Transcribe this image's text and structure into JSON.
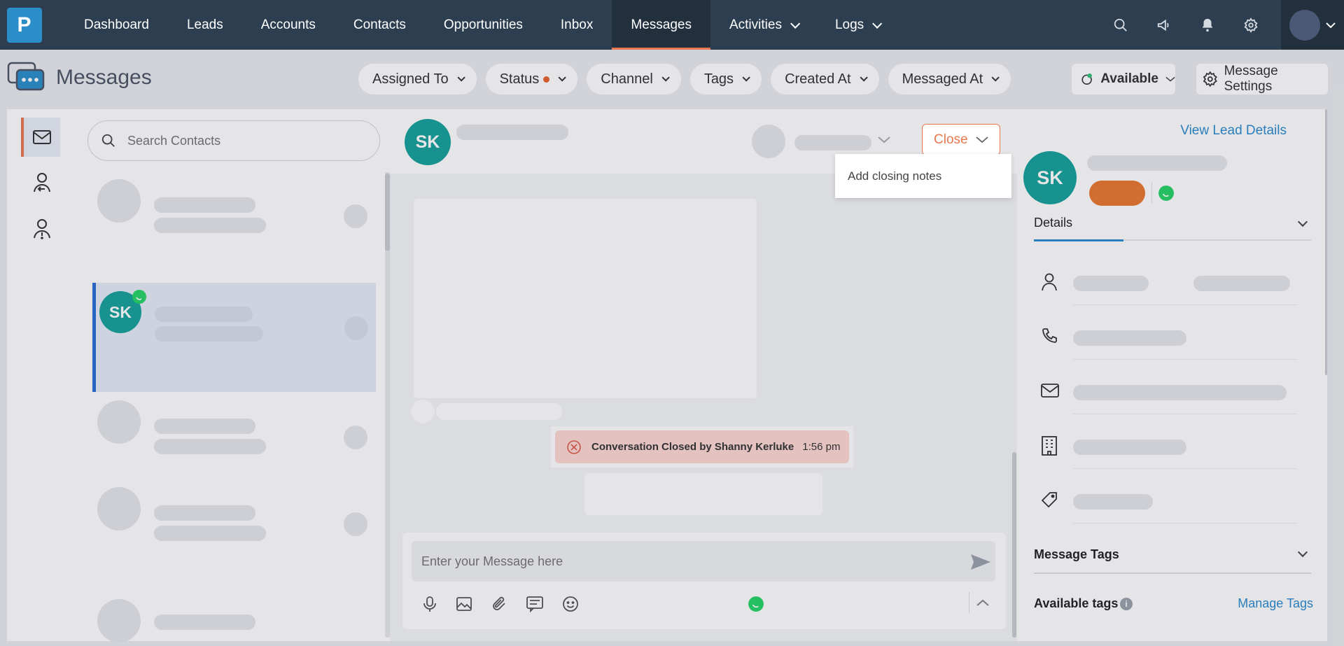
{
  "nav": {
    "logo_letter": "P",
    "items": [
      {
        "label": "Dashboard"
      },
      {
        "label": "Leads"
      },
      {
        "label": "Accounts"
      },
      {
        "label": "Contacts"
      },
      {
        "label": "Opportunities"
      },
      {
        "label": "Inbox"
      },
      {
        "label": "Messages",
        "active": true
      },
      {
        "label": "Activities",
        "dropdown": true
      },
      {
        "label": "Logs",
        "dropdown": true
      }
    ],
    "icons": [
      "search-icon",
      "megaphone-icon",
      "bell-icon",
      "gear-icon"
    ]
  },
  "page": {
    "title": "Messages",
    "filters": [
      "Assigned To",
      "Status",
      "Channel",
      "Tags",
      "Created At",
      "Messaged At"
    ],
    "availability": "Available",
    "settings_label": "Message Settings"
  },
  "contacts": {
    "search_placeholder": "Search Contacts",
    "selected_initials": "SK"
  },
  "chat": {
    "contact_initials": "SK",
    "close_label": "Close",
    "dropdown_item": "Add closing notes",
    "closed_text": "Conversation Closed by Shanny Kerluke",
    "closed_time": "1:56 pm",
    "composer_placeholder": "Enter your Message here"
  },
  "lead": {
    "view_link": "View Lead Details",
    "initials": "SK",
    "details_tab": "Details",
    "message_tags": "Message Tags",
    "available_tags": "Available tags",
    "manage_tags": "Manage Tags"
  },
  "colors": {
    "nav_bg": "#2c3e50",
    "accent": "#e9774f",
    "avatar_teal": "#15a19a",
    "link_blue": "#2a8ad0"
  }
}
